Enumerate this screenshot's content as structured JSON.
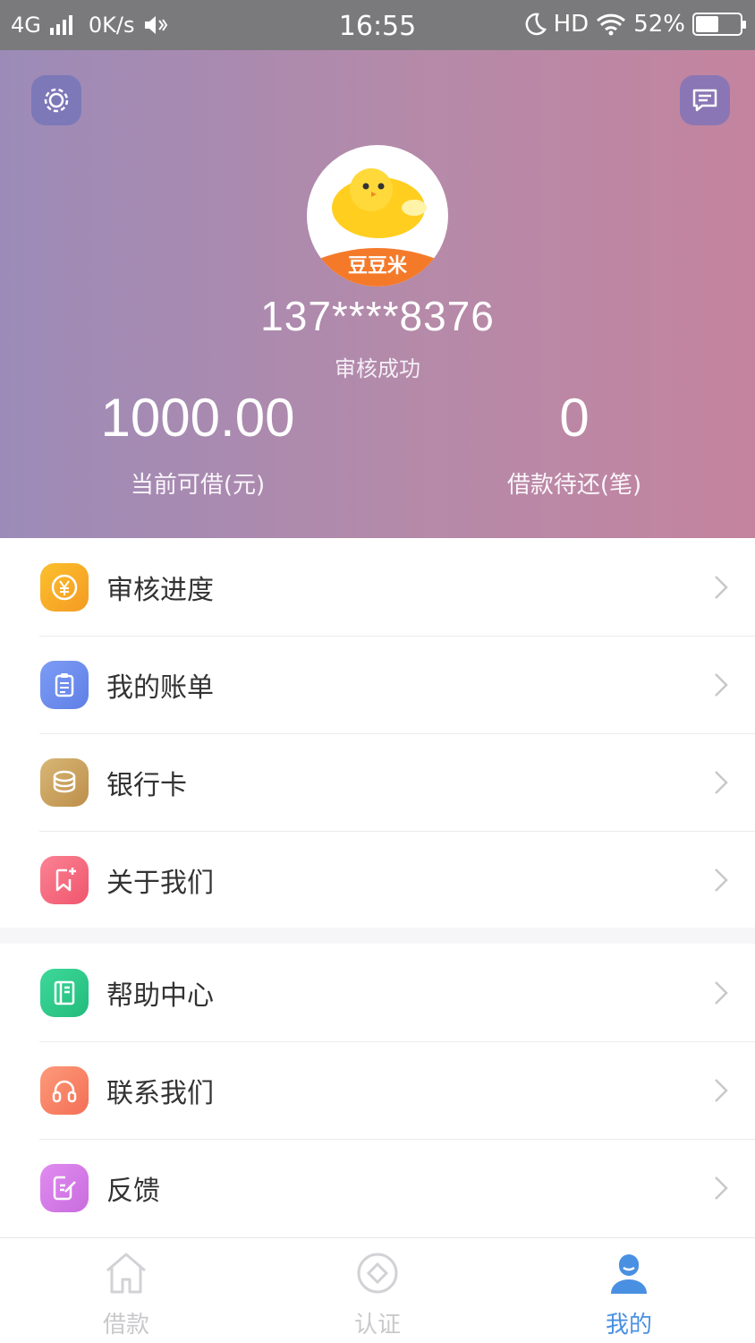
{
  "status_bar": {
    "network": "4G",
    "speed": "0K/s",
    "time": "16:55",
    "hd": "HD",
    "battery": "52%",
    "battery_level": 0.52
  },
  "profile": {
    "avatar_text": "豆豆米",
    "phone": "137****8376",
    "status": "审核成功",
    "available_amount": "1000.00",
    "available_label": "当前可借(元)",
    "pending_count": "0",
    "pending_label": "借款待还(笔)"
  },
  "menu_group1": [
    {
      "label": "审核进度",
      "icon": "yen-coin-icon",
      "color": "#f7a623"
    },
    {
      "label": "我的账单",
      "icon": "clipboard-icon",
      "color": "#6f8ff0"
    },
    {
      "label": "银行卡",
      "icon": "coin-stack-icon",
      "color": "#c9a15c"
    },
    {
      "label": "关于我们",
      "icon": "bookmark-star-icon",
      "color": "#f56a7d"
    }
  ],
  "menu_group2": [
    {
      "label": "帮助中心",
      "icon": "book-icon",
      "color": "#2ecb8c"
    },
    {
      "label": "联系我们",
      "icon": "headset-icon",
      "color": "#f98468"
    },
    {
      "label": "反馈",
      "icon": "edit-note-icon",
      "color": "#d77ee8"
    }
  ],
  "tabs": [
    {
      "label": "借款",
      "icon": "home-icon"
    },
    {
      "label": "认证",
      "icon": "diamond-circle-icon"
    },
    {
      "label": "我的",
      "icon": "user-icon"
    }
  ],
  "colors": {
    "accent": "#4a90e2",
    "header_start": "#9c8bb8",
    "header_end": "#c4849f"
  }
}
